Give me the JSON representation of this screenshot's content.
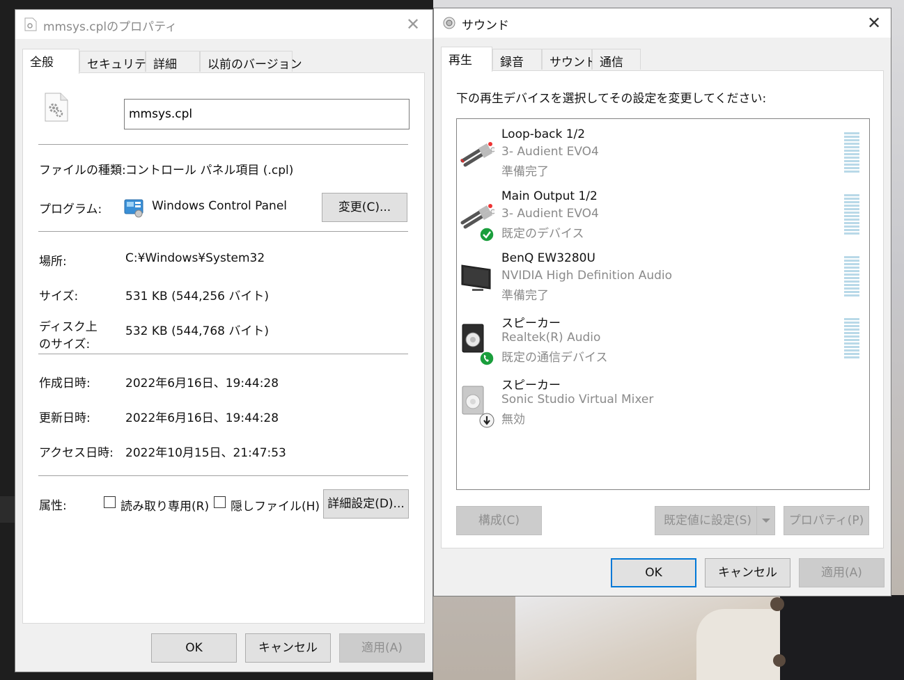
{
  "props_window": {
    "title": "mmsys.cplのプロパティ",
    "close_glyph": "✕",
    "tabs": [
      "全般",
      "セキュリティ",
      "詳細",
      "以前のバージョン"
    ],
    "file_name": "mmsys.cpl",
    "rows": {
      "type_label": "ファイルの種類:",
      "type_value": "コントロール パネル項目 (.cpl)",
      "program_label": "プログラム:",
      "program_value": "Windows Control Panel",
      "change_button": "変更(C)...",
      "location_label": "場所:",
      "location_value": "C:¥Windows¥System32",
      "size_label": "サイズ:",
      "size_value": "531 KB (544,256 バイト)",
      "disk_label_1": "ディスク上",
      "disk_label_2": "のサイズ:",
      "disk_value": "532 KB (544,768 バイト)",
      "created_label": "作成日時:",
      "created_value": "2022年6月16日、19:44:28",
      "modified_label": "更新日時:",
      "modified_value": "2022年6月16日、19:44:28",
      "accessed_label": "アクセス日時:",
      "accessed_value": "2022年10月15日、21:47:53",
      "attr_label": "属性:",
      "readonly_label": "読み取り専用(R)",
      "hidden_label": "隠しファイル(H)",
      "advanced_button": "詳細設定(D)..."
    },
    "buttons": {
      "ok": "OK",
      "cancel": "キャンセル",
      "apply": "適用(A)"
    }
  },
  "sound_window": {
    "title": "サウンド",
    "close_glyph": "✕",
    "tabs": [
      "再生",
      "録音",
      "サウンド",
      "通信"
    ],
    "instruction": "下の再生デバイスを選択してその設定を変更してください:",
    "devices": [
      {
        "name": "Loop-back 1/2",
        "sub": "3- Audient EVO4",
        "status": "準備完了",
        "icon": "rca-cable-icon",
        "badge": ""
      },
      {
        "name": "Main Output 1/2",
        "sub": "3- Audient EVO4",
        "status": "既定のデバイス",
        "icon": "rca-cable-icon",
        "badge": "default-check-icon"
      },
      {
        "name": "BenQ EW3280U",
        "sub": "NVIDIA High Definition Audio",
        "status": "準備完了",
        "icon": "monitor-icon",
        "badge": ""
      },
      {
        "name": "スピーカー",
        "sub": "Realtek(R) Audio",
        "status": "既定の通信デバイス",
        "icon": "speaker-icon",
        "badge": "phone-badge-icon"
      },
      {
        "name": "スピーカー",
        "sub": "Sonic Studio Virtual Mixer",
        "status": "無効",
        "icon": "speaker-icon",
        "badge": "disabled-arrow-icon"
      }
    ],
    "buttons": {
      "configure": "構成(C)",
      "set_default": "既定値に設定(S)",
      "properties": "プロパティ(P)",
      "ok": "OK",
      "cancel": "キャンセル",
      "apply": "適用(A)"
    }
  },
  "colors": {
    "accent": "#0078d7",
    "meter": "#b9d9e8",
    "check_green": "#1a9e3c"
  }
}
